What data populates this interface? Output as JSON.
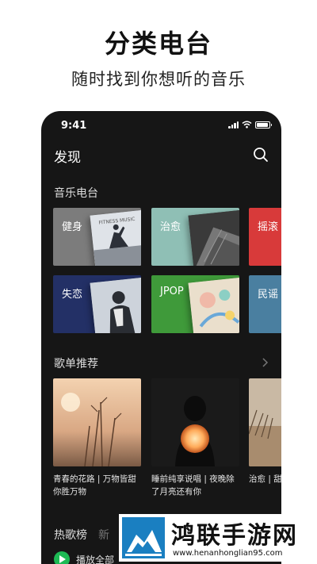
{
  "promo": {
    "title": "分类电台",
    "subtitle": "随时找到你想听的音乐"
  },
  "status_bar": {
    "time": "9:41",
    "battery_level": 0.9
  },
  "header": {
    "title": "发现",
    "search_icon": "search-icon"
  },
  "radio": {
    "title": "音乐电台",
    "tiles": [
      {
        "label": "健身",
        "color": "#7c7c7c",
        "art_text": "FITNESS MUSIC"
      },
      {
        "label": "治愈",
        "color": "#8fbfb5"
      },
      {
        "label": "摇滚",
        "color": "#d83a3a"
      },
      {
        "label": "失恋",
        "color": "#233066"
      },
      {
        "label": "JPOP",
        "color": "#3f9a3a"
      },
      {
        "label": "民谣",
        "color": "#4a7fa0"
      }
    ]
  },
  "playlists": {
    "title": "歌单推荐",
    "more_icon": "chevron-right-icon",
    "items": [
      {
        "caption": "青春的花路 | 万物皆甜你胜万物"
      },
      {
        "caption": "睡前纯享说唱 | 夜晚除了月亮还有你"
      },
      {
        "caption": "治愈 | 甜甜的歌"
      }
    ]
  },
  "hot": {
    "tabs": [
      "热歌榜",
      "新"
    ],
    "play_all": "播放全部"
  },
  "watermark": {
    "name": "鸿联手游网",
    "url": "www.henanhonglian95.com"
  },
  "colors": {
    "background": "#161616",
    "accent": "#1db954"
  }
}
